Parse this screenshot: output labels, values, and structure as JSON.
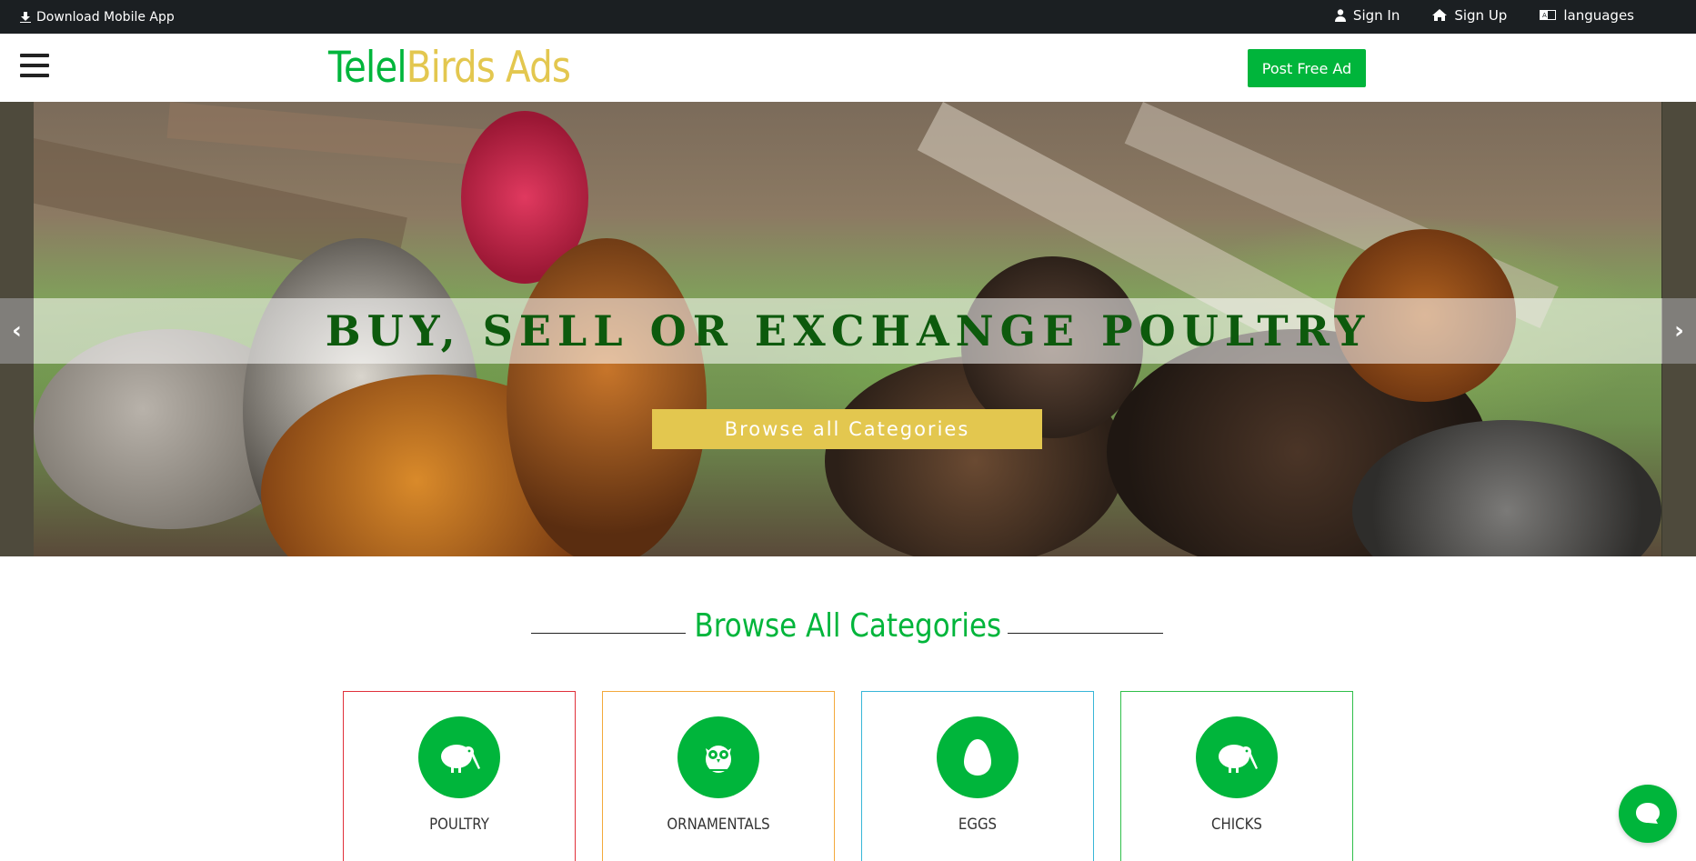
{
  "topbar": {
    "download_label": "Download Mobile App",
    "sign_in": "Sign In",
    "sign_up": "Sign Up",
    "languages": "languages"
  },
  "header": {
    "logo_part1": "Telel",
    "logo_part2": "Birds Ads",
    "post_ad": "Post Free Ad"
  },
  "hero": {
    "headline": "BUY, SELL OR EXCHANGE POULTRY",
    "browse_button": "Browse all Categories",
    "prev": "‹",
    "next": "›"
  },
  "categories": {
    "heading": "Browse All Categories",
    "items": [
      {
        "label": "POULTRY",
        "icon": "kiwi-bird-icon",
        "border": "#e0303a"
      },
      {
        "label": "ORNAMENTALS",
        "icon": "owl-icon",
        "border": "#f3a93b"
      },
      {
        "label": "EGGS",
        "icon": "egg-icon",
        "border": "#38b6d8"
      },
      {
        "label": "CHICKS",
        "icon": "kiwi-bird-icon",
        "border": "#2fbf4a"
      }
    ]
  },
  "colors": {
    "brand_green": "#00b53b",
    "brand_yellow": "#e3c74f",
    "headline_green": "#0d5a0d",
    "topbar_bg": "#1b1f22"
  }
}
